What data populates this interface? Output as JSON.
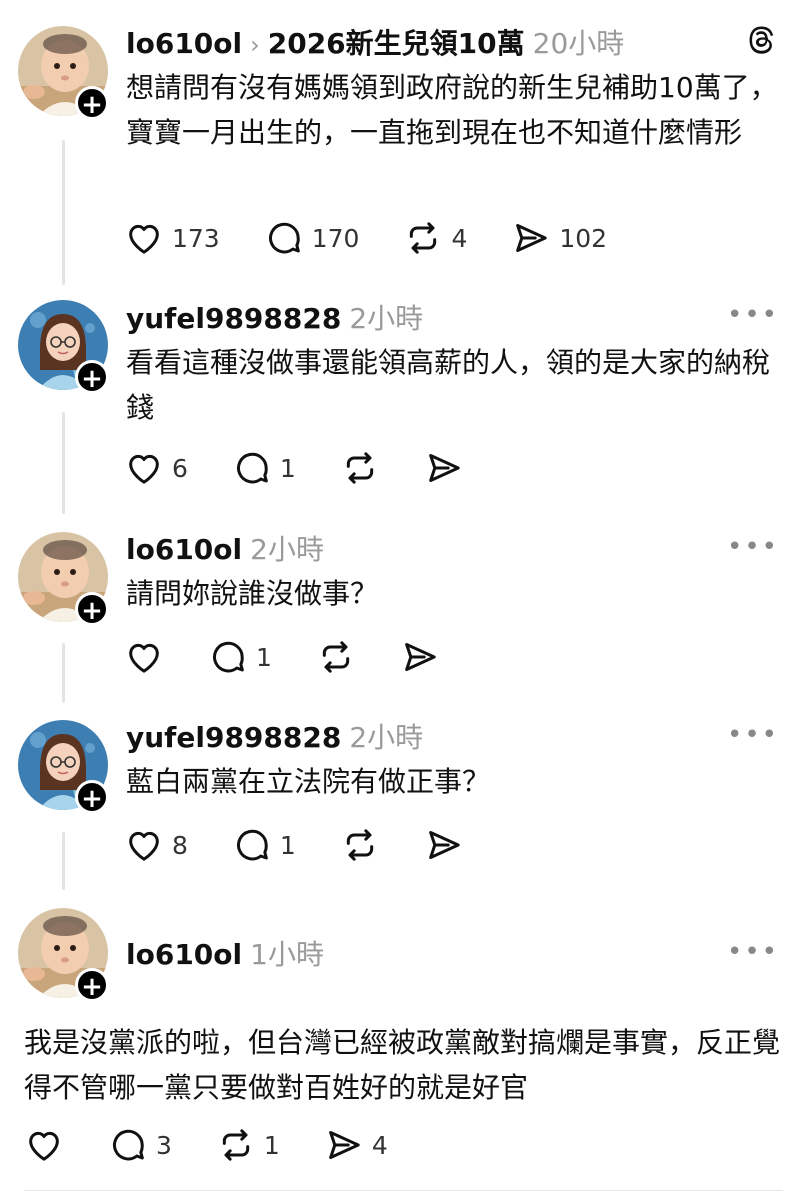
{
  "posts": [
    {
      "user": "lo610ol",
      "topic": "2026新生兒領10萬",
      "time": "20小時",
      "text": "想請問有沒有媽媽領到政府說的新生兒補助10萬了，寶寶一月出生的，一直拖到現在也不知道什麼情形",
      "likes": "173",
      "replies": "170",
      "reposts": "4",
      "shares": "102"
    },
    {
      "user": "yufel9898828",
      "time": "2小時",
      "text": "看看這種沒做事還能領高薪的人，領的是大家的納稅錢",
      "likes": "6",
      "replies": "1"
    },
    {
      "user": "lo610ol",
      "time": "2小時",
      "text": "請問妳說誰沒做事？",
      "replies": "1"
    },
    {
      "user": "yufel9898828",
      "time": "2小時",
      "text": "藍白兩黨在立法院有做正事？",
      "likes": "8",
      "replies": "1"
    },
    {
      "user": "lo610ol",
      "time": "1小時",
      "text": "我是沒黨派的啦，但台灣已經被政黨敵對搞爛是事實，反正覺得不管哪一黨只要做對百姓好的就是好官",
      "replies": "3",
      "reposts": "1",
      "shares": "4"
    }
  ],
  "icons": {
    "more": "more-icon",
    "like": "heart-icon",
    "reply": "comment-icon",
    "repost": "repost-icon",
    "share": "send-icon",
    "brand": "threads-logo-icon",
    "follow": "plus-icon"
  },
  "ui": {
    "more_glyph": "•••",
    "plus_glyph": "+",
    "chevron": "›"
  }
}
